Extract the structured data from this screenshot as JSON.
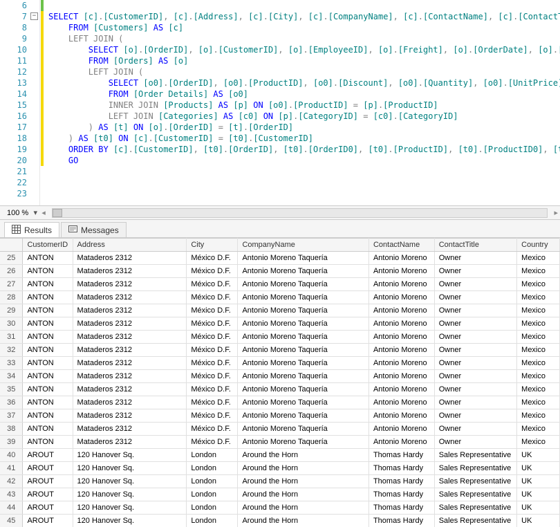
{
  "editor": {
    "lines": [
      {
        "n": 6,
        "change": "green",
        "tokens": []
      },
      {
        "n": 7,
        "change": "yellow",
        "fold": true,
        "tokens": [
          {
            "t": "SELECT ",
            "c": "kw"
          },
          {
            "t": "[c]",
            "c": "obj"
          },
          {
            "t": ".",
            "c": "op"
          },
          {
            "t": "[CustomerID]",
            "c": "obj"
          },
          {
            "t": ", ",
            "c": "op"
          },
          {
            "t": "[c]",
            "c": "obj"
          },
          {
            "t": ".",
            "c": "op"
          },
          {
            "t": "[Address]",
            "c": "obj"
          },
          {
            "t": ", ",
            "c": "op"
          },
          {
            "t": "[c]",
            "c": "obj"
          },
          {
            "t": ".",
            "c": "op"
          },
          {
            "t": "[City]",
            "c": "obj"
          },
          {
            "t": ", ",
            "c": "op"
          },
          {
            "t": "[c]",
            "c": "obj"
          },
          {
            "t": ".",
            "c": "op"
          },
          {
            "t": "[CompanyName]",
            "c": "obj"
          },
          {
            "t": ", ",
            "c": "op"
          },
          {
            "t": "[c]",
            "c": "obj"
          },
          {
            "t": ".",
            "c": "op"
          },
          {
            "t": "[ContactName]",
            "c": "obj"
          },
          {
            "t": ", ",
            "c": "op"
          },
          {
            "t": "[c]",
            "c": "obj"
          },
          {
            "t": ".",
            "c": "op"
          },
          {
            "t": "[ContactT",
            "c": "obj"
          }
        ]
      },
      {
        "n": 8,
        "change": "yellow",
        "indent": 1,
        "tokens": [
          {
            "t": "FROM ",
            "c": "kw"
          },
          {
            "t": "[Customers]",
            "c": "obj"
          },
          {
            "t": " AS ",
            "c": "kw"
          },
          {
            "t": "[c]",
            "c": "obj"
          }
        ]
      },
      {
        "n": 9,
        "change": "yellow",
        "indent": 1,
        "tokens": [
          {
            "t": "LEFT JOIN",
            "c": "op"
          },
          {
            "t": " (",
            "c": "op"
          }
        ]
      },
      {
        "n": 10,
        "change": "yellow",
        "indent": 2,
        "tokens": [
          {
            "t": "SELECT ",
            "c": "kw"
          },
          {
            "t": "[o]",
            "c": "obj"
          },
          {
            "t": ".",
            "c": "op"
          },
          {
            "t": "[OrderID]",
            "c": "obj"
          },
          {
            "t": ", ",
            "c": "op"
          },
          {
            "t": "[o]",
            "c": "obj"
          },
          {
            "t": ".",
            "c": "op"
          },
          {
            "t": "[CustomerID]",
            "c": "obj"
          },
          {
            "t": ", ",
            "c": "op"
          },
          {
            "t": "[o]",
            "c": "obj"
          },
          {
            "t": ".",
            "c": "op"
          },
          {
            "t": "[EmployeeID]",
            "c": "obj"
          },
          {
            "t": ", ",
            "c": "op"
          },
          {
            "t": "[o]",
            "c": "obj"
          },
          {
            "t": ".",
            "c": "op"
          },
          {
            "t": "[Freight]",
            "c": "obj"
          },
          {
            "t": ", ",
            "c": "op"
          },
          {
            "t": "[o]",
            "c": "obj"
          },
          {
            "t": ".",
            "c": "op"
          },
          {
            "t": "[OrderDate]",
            "c": "obj"
          },
          {
            "t": ", ",
            "c": "op"
          },
          {
            "t": "[o]",
            "c": "obj"
          },
          {
            "t": ".",
            "c": "op"
          },
          {
            "t": "[Requ",
            "c": "obj"
          }
        ]
      },
      {
        "n": 11,
        "change": "yellow",
        "indent": 2,
        "tokens": [
          {
            "t": "FROM ",
            "c": "kw"
          },
          {
            "t": "[Orders]",
            "c": "obj"
          },
          {
            "t": " AS ",
            "c": "kw"
          },
          {
            "t": "[o]",
            "c": "obj"
          }
        ]
      },
      {
        "n": 12,
        "change": "yellow",
        "indent": 2,
        "tokens": [
          {
            "t": "LEFT JOIN",
            "c": "op"
          },
          {
            "t": " (",
            "c": "op"
          }
        ]
      },
      {
        "n": 13,
        "change": "yellow",
        "indent": 3,
        "tokens": [
          {
            "t": "SELECT ",
            "c": "kw"
          },
          {
            "t": "[o0]",
            "c": "obj"
          },
          {
            "t": ".",
            "c": "op"
          },
          {
            "t": "[OrderID]",
            "c": "obj"
          },
          {
            "t": ", ",
            "c": "op"
          },
          {
            "t": "[o0]",
            "c": "obj"
          },
          {
            "t": ".",
            "c": "op"
          },
          {
            "t": "[ProductID]",
            "c": "obj"
          },
          {
            "t": ", ",
            "c": "op"
          },
          {
            "t": "[o0]",
            "c": "obj"
          },
          {
            "t": ".",
            "c": "op"
          },
          {
            "t": "[Discount]",
            "c": "obj"
          },
          {
            "t": ", ",
            "c": "op"
          },
          {
            "t": "[o0]",
            "c": "obj"
          },
          {
            "t": ".",
            "c": "op"
          },
          {
            "t": "[Quantity]",
            "c": "obj"
          },
          {
            "t": ", ",
            "c": "op"
          },
          {
            "t": "[o0]",
            "c": "obj"
          },
          {
            "t": ".",
            "c": "op"
          },
          {
            "t": "[UnitPrice]",
            "c": "obj"
          },
          {
            "t": ", ",
            "c": "op"
          },
          {
            "t": "[p",
            "c": "obj"
          }
        ]
      },
      {
        "n": 14,
        "change": "yellow",
        "indent": 3,
        "tokens": [
          {
            "t": "FROM ",
            "c": "kw"
          },
          {
            "t": "[Order Details]",
            "c": "obj"
          },
          {
            "t": " AS ",
            "c": "kw"
          },
          {
            "t": "[o0]",
            "c": "obj"
          }
        ]
      },
      {
        "n": 15,
        "change": "yellow",
        "indent": 3,
        "tokens": [
          {
            "t": "INNER JOIN",
            "c": "op"
          },
          {
            "t": " ",
            "c": "op"
          },
          {
            "t": "[Products]",
            "c": "obj"
          },
          {
            "t": " AS ",
            "c": "kw"
          },
          {
            "t": "[p]",
            "c": "obj"
          },
          {
            "t": " ON ",
            "c": "kw"
          },
          {
            "t": "[o0]",
            "c": "obj"
          },
          {
            "t": ".",
            "c": "op"
          },
          {
            "t": "[ProductID]",
            "c": "obj"
          },
          {
            "t": " = ",
            "c": "op"
          },
          {
            "t": "[p]",
            "c": "obj"
          },
          {
            "t": ".",
            "c": "op"
          },
          {
            "t": "[ProductID]",
            "c": "obj"
          }
        ]
      },
      {
        "n": 16,
        "change": "yellow",
        "indent": 3,
        "tokens": [
          {
            "t": "LEFT JOIN",
            "c": "op"
          },
          {
            "t": " ",
            "c": "op"
          },
          {
            "t": "[Categories]",
            "c": "obj"
          },
          {
            "t": " AS ",
            "c": "kw"
          },
          {
            "t": "[c0]",
            "c": "obj"
          },
          {
            "t": " ON ",
            "c": "kw"
          },
          {
            "t": "[p]",
            "c": "obj"
          },
          {
            "t": ".",
            "c": "op"
          },
          {
            "t": "[CategoryID]",
            "c": "obj"
          },
          {
            "t": " = ",
            "c": "op"
          },
          {
            "t": "[c0]",
            "c": "obj"
          },
          {
            "t": ".",
            "c": "op"
          },
          {
            "t": "[CategoryID]",
            "c": "obj"
          }
        ]
      },
      {
        "n": 17,
        "change": "yellow",
        "indent": 2,
        "tokens": [
          {
            "t": ")",
            "c": "op"
          },
          {
            "t": " AS ",
            "c": "kw"
          },
          {
            "t": "[t]",
            "c": "obj"
          },
          {
            "t": " ON ",
            "c": "kw"
          },
          {
            "t": "[o]",
            "c": "obj"
          },
          {
            "t": ".",
            "c": "op"
          },
          {
            "t": "[OrderID]",
            "c": "obj"
          },
          {
            "t": " = ",
            "c": "op"
          },
          {
            "t": "[t]",
            "c": "obj"
          },
          {
            "t": ".",
            "c": "op"
          },
          {
            "t": "[OrderID]",
            "c": "obj"
          }
        ]
      },
      {
        "n": 18,
        "change": "yellow",
        "indent": 1,
        "tokens": [
          {
            "t": ")",
            "c": "op"
          },
          {
            "t": " AS ",
            "c": "kw"
          },
          {
            "t": "[t0]",
            "c": "obj"
          },
          {
            "t": " ON ",
            "c": "kw"
          },
          {
            "t": "[c]",
            "c": "obj"
          },
          {
            "t": ".",
            "c": "op"
          },
          {
            "t": "[CustomerID]",
            "c": "obj"
          },
          {
            "t": " = ",
            "c": "op"
          },
          {
            "t": "[t0]",
            "c": "obj"
          },
          {
            "t": ".",
            "c": "op"
          },
          {
            "t": "[CustomerID]",
            "c": "obj"
          }
        ]
      },
      {
        "n": 19,
        "change": "yellow",
        "indent": 1,
        "tokens": [
          {
            "t": "ORDER BY ",
            "c": "kw"
          },
          {
            "t": "[c]",
            "c": "obj"
          },
          {
            "t": ".",
            "c": "op"
          },
          {
            "t": "[CustomerID]",
            "c": "obj"
          },
          {
            "t": ", ",
            "c": "op"
          },
          {
            "t": "[t0]",
            "c": "obj"
          },
          {
            "t": ".",
            "c": "op"
          },
          {
            "t": "[OrderID]",
            "c": "obj"
          },
          {
            "t": ", ",
            "c": "op"
          },
          {
            "t": "[t0]",
            "c": "obj"
          },
          {
            "t": ".",
            "c": "op"
          },
          {
            "t": "[OrderID0]",
            "c": "obj"
          },
          {
            "t": ", ",
            "c": "op"
          },
          {
            "t": "[t0]",
            "c": "obj"
          },
          {
            "t": ".",
            "c": "op"
          },
          {
            "t": "[ProductID]",
            "c": "obj"
          },
          {
            "t": ", ",
            "c": "op"
          },
          {
            "t": "[t0]",
            "c": "obj"
          },
          {
            "t": ".",
            "c": "op"
          },
          {
            "t": "[ProductID0]",
            "c": "obj"
          },
          {
            "t": ", ",
            "c": "op"
          },
          {
            "t": "[t0]",
            "c": "obj"
          },
          {
            "t": ".",
            "c": "op"
          },
          {
            "t": "[",
            "c": "obj"
          }
        ]
      },
      {
        "n": 20,
        "change": "yellow",
        "indent": 1,
        "tokens": [
          {
            "t": "GO",
            "c": "kw"
          }
        ]
      },
      {
        "n": 21,
        "change": "",
        "tokens": []
      },
      {
        "n": 22,
        "change": "",
        "tokens": []
      },
      {
        "n": 23,
        "change": "",
        "tokens": []
      }
    ]
  },
  "zoom": {
    "value": "100 %"
  },
  "tabs": {
    "results": "Results",
    "messages": "Messages"
  },
  "grid": {
    "headers": [
      "",
      "CustomerID",
      "Address",
      "City",
      "CompanyName",
      "ContactName",
      "ContactTitle",
      "Country"
    ],
    "rows": [
      {
        "n": 25,
        "cust": "ANTON",
        "addr": "Mataderos  2312",
        "city": "México D.F.",
        "comp": "Antonio Moreno Taquería",
        "name": "Antonio Moreno",
        "title": "Owner",
        "ctry": "Mexico"
      },
      {
        "n": 26,
        "cust": "ANTON",
        "addr": "Mataderos  2312",
        "city": "México D.F.",
        "comp": "Antonio Moreno Taquería",
        "name": "Antonio Moreno",
        "title": "Owner",
        "ctry": "Mexico"
      },
      {
        "n": 27,
        "cust": "ANTON",
        "addr": "Mataderos  2312",
        "city": "México D.F.",
        "comp": "Antonio Moreno Taquería",
        "name": "Antonio Moreno",
        "title": "Owner",
        "ctry": "Mexico"
      },
      {
        "n": 28,
        "cust": "ANTON",
        "addr": "Mataderos  2312",
        "city": "México D.F.",
        "comp": "Antonio Moreno Taquería",
        "name": "Antonio Moreno",
        "title": "Owner",
        "ctry": "Mexico"
      },
      {
        "n": 29,
        "cust": "ANTON",
        "addr": "Mataderos  2312",
        "city": "México D.F.",
        "comp": "Antonio Moreno Taquería",
        "name": "Antonio Moreno",
        "title": "Owner",
        "ctry": "Mexico"
      },
      {
        "n": 30,
        "cust": "ANTON",
        "addr": "Mataderos  2312",
        "city": "México D.F.",
        "comp": "Antonio Moreno Taquería",
        "name": "Antonio Moreno",
        "title": "Owner",
        "ctry": "Mexico"
      },
      {
        "n": 31,
        "cust": "ANTON",
        "addr": "Mataderos  2312",
        "city": "México D.F.",
        "comp": "Antonio Moreno Taquería",
        "name": "Antonio Moreno",
        "title": "Owner",
        "ctry": "Mexico"
      },
      {
        "n": 32,
        "cust": "ANTON",
        "addr": "Mataderos  2312",
        "city": "México D.F.",
        "comp": "Antonio Moreno Taquería",
        "name": "Antonio Moreno",
        "title": "Owner",
        "ctry": "Mexico"
      },
      {
        "n": 33,
        "cust": "ANTON",
        "addr": "Mataderos  2312",
        "city": "México D.F.",
        "comp": "Antonio Moreno Taquería",
        "name": "Antonio Moreno",
        "title": "Owner",
        "ctry": "Mexico"
      },
      {
        "n": 34,
        "cust": "ANTON",
        "addr": "Mataderos  2312",
        "city": "México D.F.",
        "comp": "Antonio Moreno Taquería",
        "name": "Antonio Moreno",
        "title": "Owner",
        "ctry": "Mexico"
      },
      {
        "n": 35,
        "cust": "ANTON",
        "addr": "Mataderos  2312",
        "city": "México D.F.",
        "comp": "Antonio Moreno Taquería",
        "name": "Antonio Moreno",
        "title": "Owner",
        "ctry": "Mexico"
      },
      {
        "n": 36,
        "cust": "ANTON",
        "addr": "Mataderos  2312",
        "city": "México D.F.",
        "comp": "Antonio Moreno Taquería",
        "name": "Antonio Moreno",
        "title": "Owner",
        "ctry": "Mexico"
      },
      {
        "n": 37,
        "cust": "ANTON",
        "addr": "Mataderos  2312",
        "city": "México D.F.",
        "comp": "Antonio Moreno Taquería",
        "name": "Antonio Moreno",
        "title": "Owner",
        "ctry": "Mexico"
      },
      {
        "n": 38,
        "cust": "ANTON",
        "addr": "Mataderos  2312",
        "city": "México D.F.",
        "comp": "Antonio Moreno Taquería",
        "name": "Antonio Moreno",
        "title": "Owner",
        "ctry": "Mexico"
      },
      {
        "n": 39,
        "cust": "ANTON",
        "addr": "Mataderos  2312",
        "city": "México D.F.",
        "comp": "Antonio Moreno Taquería",
        "name": "Antonio Moreno",
        "title": "Owner",
        "ctry": "Mexico"
      },
      {
        "n": 40,
        "cust": "AROUT",
        "addr": "120 Hanover Sq.",
        "city": "London",
        "comp": "Around the Horn",
        "name": "Thomas Hardy",
        "title": "Sales Representative",
        "ctry": "UK"
      },
      {
        "n": 41,
        "cust": "AROUT",
        "addr": "120 Hanover Sq.",
        "city": "London",
        "comp": "Around the Horn",
        "name": "Thomas Hardy",
        "title": "Sales Representative",
        "ctry": "UK"
      },
      {
        "n": 42,
        "cust": "AROUT",
        "addr": "120 Hanover Sq.",
        "city": "London",
        "comp": "Around the Horn",
        "name": "Thomas Hardy",
        "title": "Sales Representative",
        "ctry": "UK"
      },
      {
        "n": 43,
        "cust": "AROUT",
        "addr": "120 Hanover Sq.",
        "city": "London",
        "comp": "Around the Horn",
        "name": "Thomas Hardy",
        "title": "Sales Representative",
        "ctry": "UK"
      },
      {
        "n": 44,
        "cust": "AROUT",
        "addr": "120 Hanover Sq.",
        "city": "London",
        "comp": "Around the Horn",
        "name": "Thomas Hardy",
        "title": "Sales Representative",
        "ctry": "UK"
      },
      {
        "n": 45,
        "cust": "AROUT",
        "addr": "120 Hanover Sq.",
        "city": "London",
        "comp": "Around the Horn",
        "name": "Thomas Hardy",
        "title": "Sales Representative",
        "ctry": "UK"
      }
    ]
  }
}
